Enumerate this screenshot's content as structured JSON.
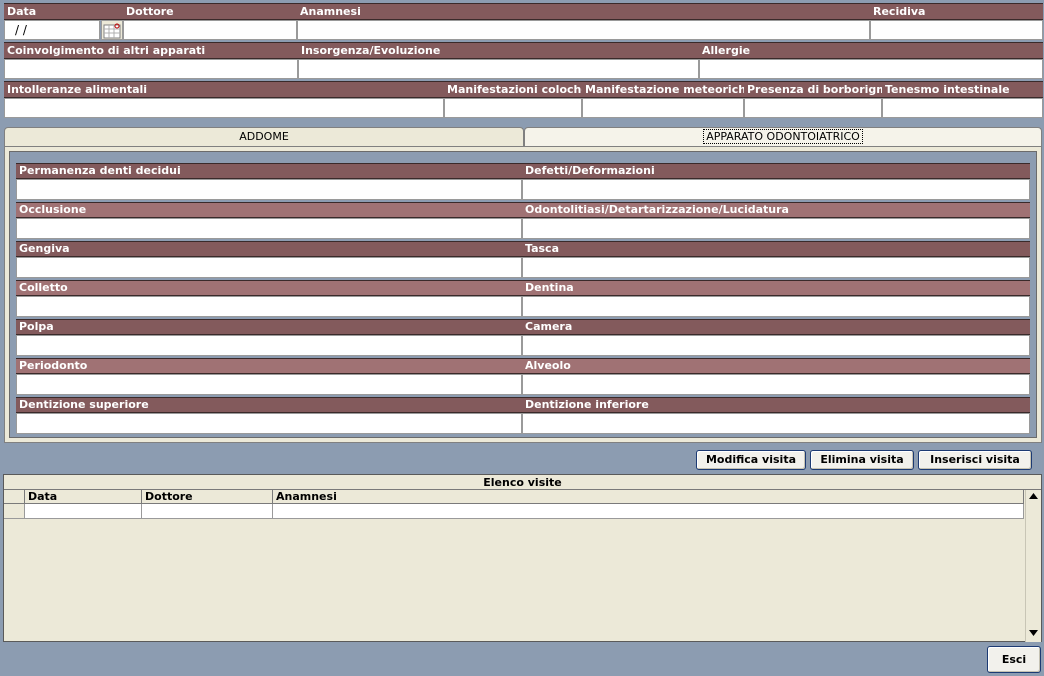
{
  "top": {
    "row1": {
      "data_label": "Data",
      "data_value": " /  /",
      "dottore_label": "Dottore",
      "anamnesi_label": "Anamnesi",
      "recidiva_label": "Recidiva"
    },
    "row2": {
      "coinvolgimento_label": "Coinvolgimento di altri apparati",
      "insorgenza_label": "Insorgenza/Evoluzione",
      "allergie_label": "Allergie"
    },
    "row3": {
      "intolleranze_label": "Intolleranze alimentali",
      "coloche_label": "Manifestazioni coloche",
      "meteoriche_label": "Manifestazione meteoriche",
      "borborigmi_label": "Presenza di borborigmi",
      "tenesmo_label": "Tenesmo intestinale"
    }
  },
  "tabs": [
    {
      "label": "ADDOME",
      "active": false
    },
    {
      "label": "APPARATO ODONTOIATRICO",
      "active": true
    }
  ],
  "odonto": {
    "left": [
      "Permanenza denti decidui",
      "Occlusione",
      "Gengiva",
      "Colletto",
      "Polpa",
      "Periodonto",
      "Dentizione superiore"
    ],
    "right": [
      "Defetti/Deformazioni",
      "Odontolitiasi/Detartarizzazione/Lucidatura",
      "Tasca",
      "Dentina",
      "Camera",
      "Alveolo",
      "Dentizione inferiore"
    ]
  },
  "buttons": {
    "modifica": "Modifica visita",
    "elimina": "Elimina visita",
    "inserisci": "Inserisci visita",
    "esci": "Esci"
  },
  "visits": {
    "title": "Elenco visite",
    "columns": [
      "Data",
      "Dottore",
      "Anamnesi"
    ]
  },
  "colors": {
    "header_dark": "#835a5c",
    "header_light": "#a07274",
    "background": "#8c9cb1",
    "panel": "#ece9d8"
  }
}
